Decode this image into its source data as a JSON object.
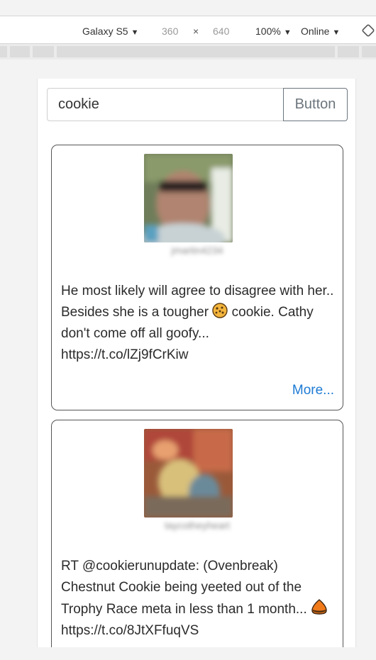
{
  "devtools": {
    "device": "Galaxy S5",
    "width": "360",
    "times": "×",
    "height": "640",
    "zoom": "100%",
    "network": "Online",
    "arrow": "▼"
  },
  "search": {
    "value": "cookie",
    "button_label": "Button"
  },
  "cards": [
    {
      "username": "jmartin4234",
      "text_before_emoji": "He most likely will agree to disagree with her.. Besides she is a tougher ",
      "emoji": "cookie-emoji",
      "text_after_emoji": " cookie. Cathy don't come off all goofy... https://t.co/lZj9fCrKiw",
      "more_label": "More..."
    },
    {
      "username": "taycotheyheart",
      "text_before_emoji": "RT @cookierunupdate: (Ovenbreak) Chestnut Cookie being yeeted out of the Trophy Race meta in less than 1 month... ",
      "emoji": "chestnut-emoji",
      "text_after_emoji": " https://t.co/8JtXFfuqVS"
    }
  ],
  "colors": {
    "link": "#1e7bd4",
    "button_outline": "#6c757d",
    "card_border": "#555555"
  }
}
